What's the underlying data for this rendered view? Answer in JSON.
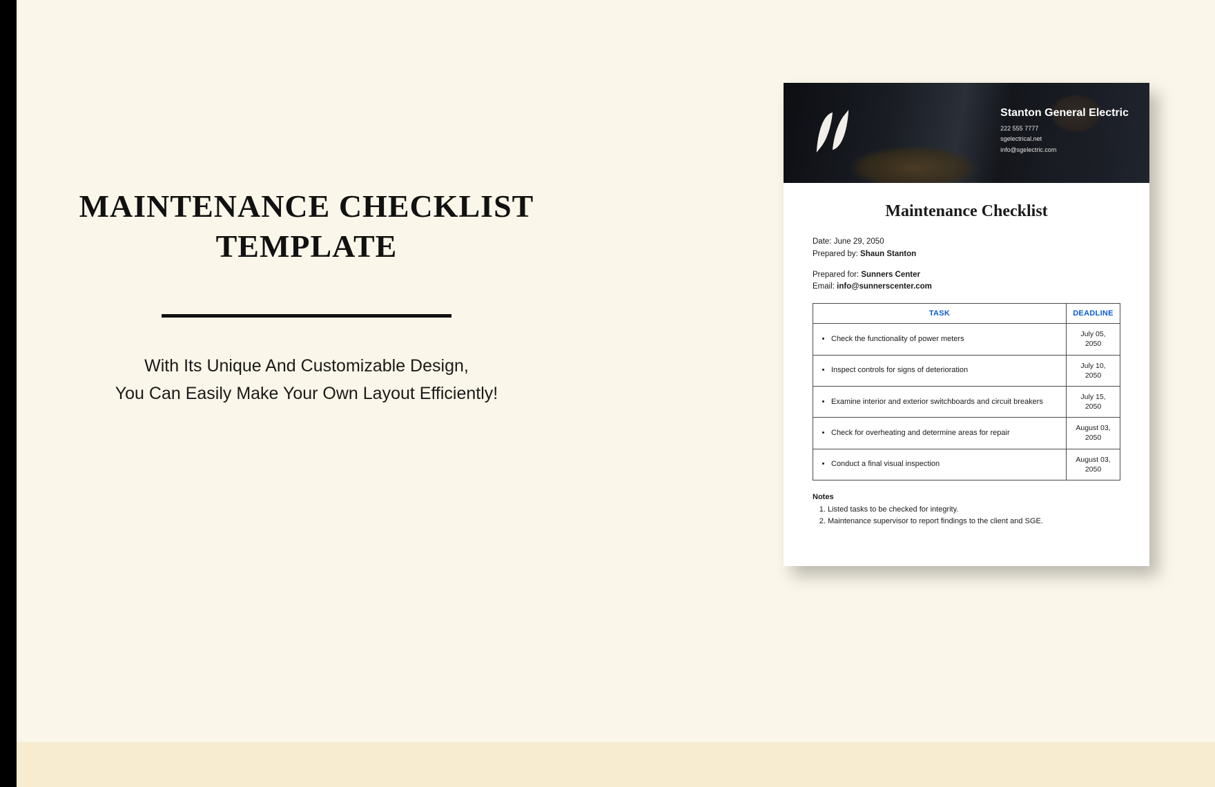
{
  "left": {
    "title_line1": "MAINTENANCE CHECKLIST",
    "title_line2": "TEMPLATE",
    "sub_line1": "With Its Unique And Customizable Design,",
    "sub_line2": "You Can Easily Make Your Own Layout Efficiently!"
  },
  "doc": {
    "company": {
      "name": "Stanton General Electric",
      "phone": "222 555 7777",
      "site": "sgelectrical.net",
      "email": "info@sgelectric.com"
    },
    "title": "Maintenance Checklist",
    "date_label": "Date: ",
    "date_value": "June 29, 2050",
    "prepared_by_label": "Prepared by: ",
    "prepared_by_value": "Shaun Stanton",
    "prepared_for_label": "Prepared for: ",
    "prepared_for_value": "Sunners Center",
    "email_label": "Email: ",
    "email_value": "info@sunnerscenter.com",
    "table": {
      "task_header": "TASK",
      "deadline_header": "DEADLINE",
      "rows": [
        {
          "task": "Check the functionality of power meters",
          "deadline": "July 05, 2050"
        },
        {
          "task": "Inspect controls for signs of deterioration",
          "deadline": "July 10, 2050"
        },
        {
          "task": "Examine interior and exterior switchboards and circuit breakers",
          "deadline": "July 15, 2050"
        },
        {
          "task": "Check for overheating and determine areas for repair",
          "deadline": "August 03, 2050"
        },
        {
          "task": "Conduct a final visual inspection",
          "deadline": "August 03, 2050"
        }
      ]
    },
    "notes": {
      "title": "Notes",
      "items": [
        "Listed tasks to be checked for integrity.",
        "Maintenance supervisor to report findings to the client and SGE."
      ]
    }
  }
}
